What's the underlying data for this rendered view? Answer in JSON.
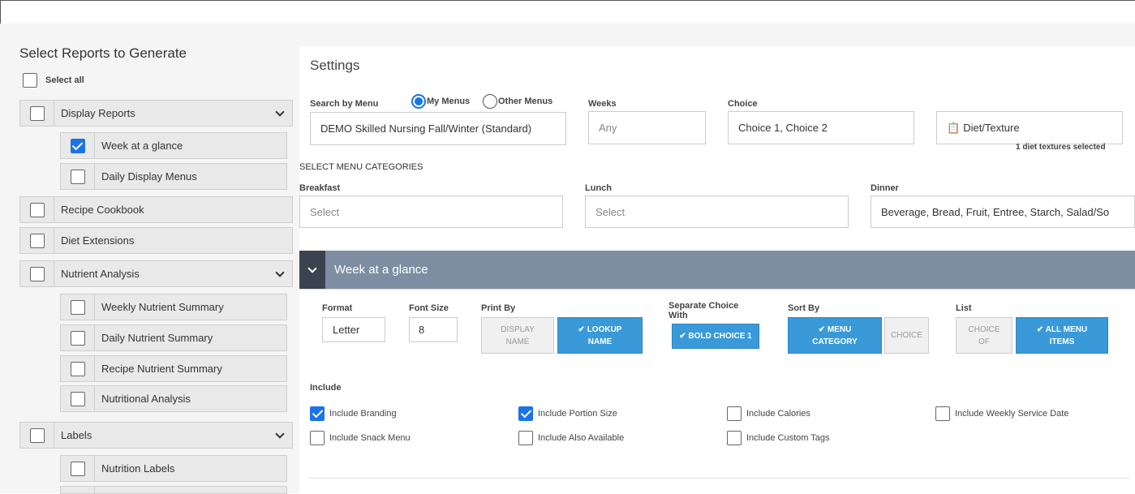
{
  "left": {
    "title": "Select Reports to Generate",
    "select_all": "Select all",
    "groups": [
      {
        "label": "Display Reports",
        "checked": false,
        "expandable": true,
        "children": [
          {
            "label": "Week at a glance",
            "checked": true
          },
          {
            "label": "Daily Display Menus",
            "checked": false
          }
        ]
      },
      {
        "label": "Recipe Cookbook",
        "checked": false,
        "expandable": false,
        "children": []
      },
      {
        "label": "Diet Extensions",
        "checked": false,
        "expandable": false,
        "children": []
      },
      {
        "label": "Nutrient Analysis",
        "checked": false,
        "expandable": true,
        "children": [
          {
            "label": "Weekly Nutrient Summary"
          },
          {
            "label": "Daily Nutrient Summary"
          },
          {
            "label": "Recipe Nutrient Summary"
          },
          {
            "label": "Nutritional Analysis"
          }
        ]
      },
      {
        "label": "Labels",
        "checked": false,
        "expandable": true,
        "children": [
          {
            "label": "Nutrition Labels"
          }
        ]
      }
    ]
  },
  "settings": {
    "title": "Settings",
    "search_by_menu_label": "Search by Menu",
    "radio_my": "My Menus",
    "radio_other": "Other Menus",
    "menu_value": "DEMO Skilled Nursing Fall/Winter (Standard)",
    "weeks_label": "Weeks",
    "weeks_placeholder": "Any",
    "choice_label": "Choice",
    "choice_value": "Choice 1, Choice 2",
    "diet_button": "Diet/Texture",
    "diet_note": "1 diet textures selected",
    "categories_heading": "SELECT MENU CATEGORIES",
    "breakfast_label": "Breakfast",
    "breakfast_placeholder": "Select",
    "lunch_label": "Lunch",
    "lunch_placeholder": "Select",
    "dinner_label": "Dinner",
    "dinner_value": "Beverage, Bread, Fruit, Entree, Starch, Salad/So"
  },
  "section": {
    "title": "Week at a glance",
    "format_label": "Format",
    "format_value": "Letter",
    "font_size_label": "Font Size",
    "font_size_value": "8",
    "print_by_label": "Print By",
    "print_by_display": "DISPLAY NAME",
    "print_by_lookup": "✔ LOOKUP NAME",
    "separate_label": "Separate Choice With",
    "separate_bold": "✔ BOLD CHOICE 1",
    "sort_by_label": "Sort By",
    "sort_menu_category": "✔ MENU CATEGORY",
    "sort_choice": "CHOICE",
    "list_label": "List",
    "list_choice_of": "CHOICE OF",
    "list_all_items": "✔ ALL MENU ITEMS",
    "include_label": "Include",
    "includes": [
      {
        "label": "Include Branding",
        "checked": true
      },
      {
        "label": "Include Portion Size",
        "checked": true
      },
      {
        "label": "Include Calories",
        "checked": false
      },
      {
        "label": "Include Weekly Service Date",
        "checked": false
      },
      {
        "label": "Include Snack Menu",
        "checked": false
      },
      {
        "label": "Include Also Available",
        "checked": false
      },
      {
        "label": "Include Custom Tags",
        "checked": false
      }
    ]
  },
  "colors": {
    "accent": "#1a73e8",
    "button_on": "#3a9ad9",
    "section_header": "#7d8ea3"
  }
}
